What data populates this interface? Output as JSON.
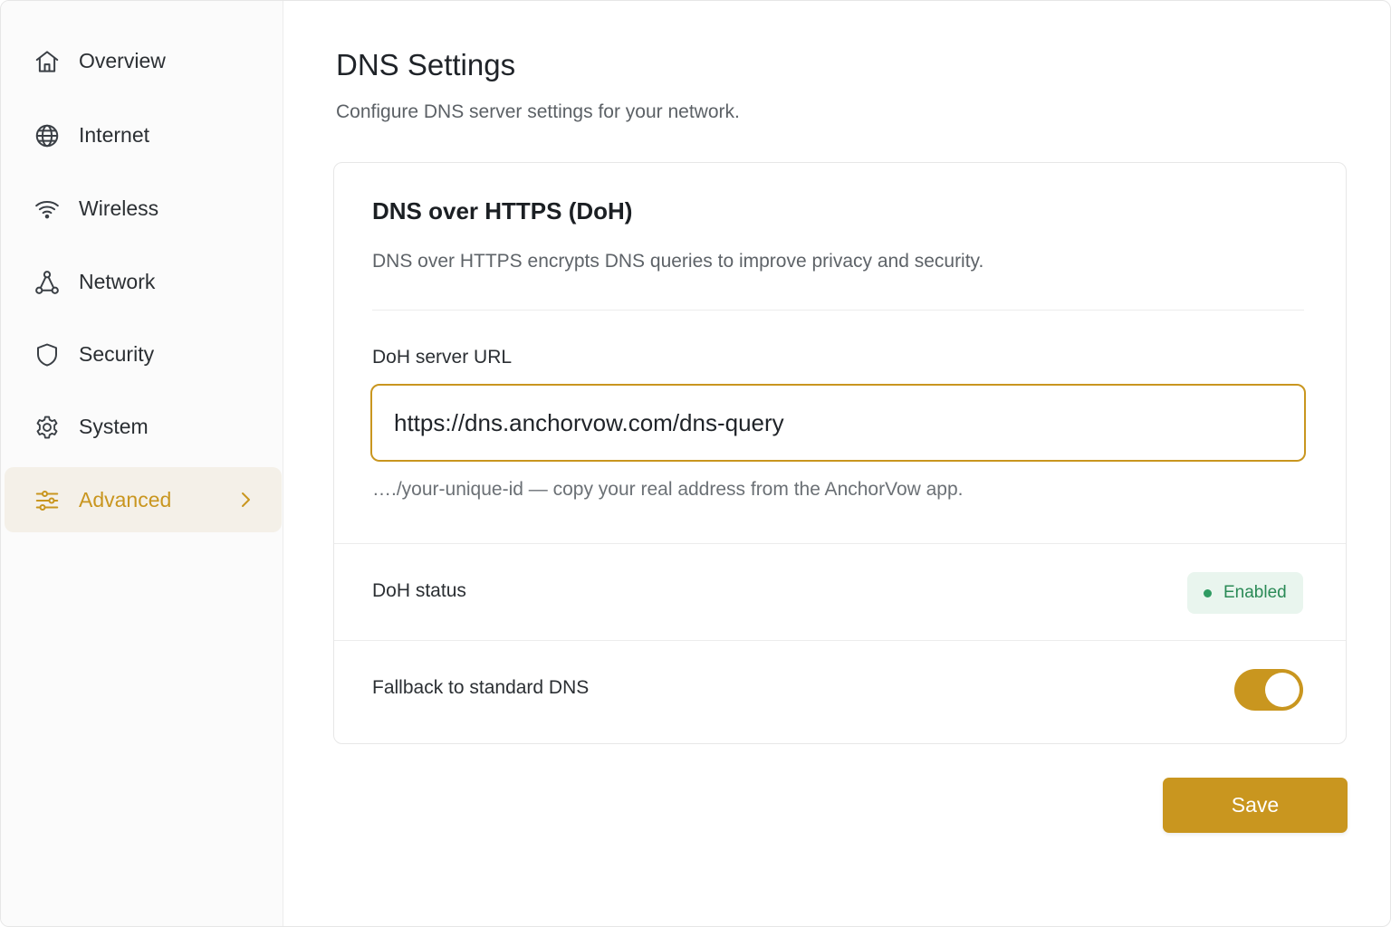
{
  "sidebar": {
    "items": [
      {
        "label": "Overview",
        "icon": "home-icon"
      },
      {
        "label": "Internet",
        "icon": "globe-icon"
      },
      {
        "label": "Wireless",
        "icon": "wifi-icon"
      },
      {
        "label": "Network",
        "icon": "network-icon"
      },
      {
        "label": "Security",
        "icon": "shield-icon"
      },
      {
        "label": "System",
        "icon": "gear-icon"
      },
      {
        "label": "Advanced",
        "icon": "sliders-icon",
        "active": true
      }
    ]
  },
  "page": {
    "title": "DNS Settings",
    "subtitle": "Configure DNS server settings for your network."
  },
  "doh": {
    "title": "DNS over HTTPS (DoH)",
    "description": "DNS over HTTPS encrypts DNS queries to improve privacy and security.",
    "url_label": "DoH server URL",
    "url_value": "https://dns.anchorvow.com/dns-query",
    "hint": "…./your-unique-id — copy your real address from the AnchorVow app.",
    "status_label": "DoH status",
    "status_value": "Enabled",
    "fallback_label": "Fallback to standard DNS",
    "fallback_enabled": true
  },
  "actions": {
    "save_label": "Save"
  },
  "colors": {
    "accent": "#c9961f",
    "active_bg": "#f4f0e8",
    "success": "#2f9b62",
    "success_bg": "#e9f5ee"
  }
}
